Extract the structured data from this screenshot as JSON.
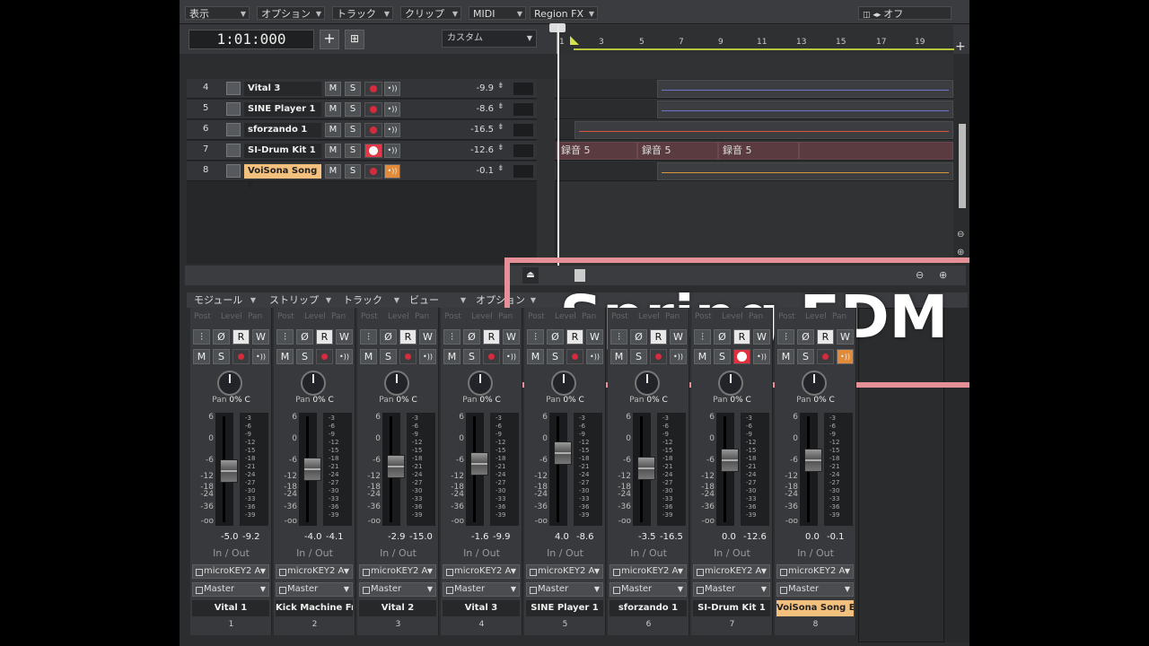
{
  "menu": [
    "表示",
    "オプション",
    "トラック",
    "クリップ",
    "MIDI",
    "Region FX"
  ],
  "menu_right": "オフ",
  "timecode": "1:01:000",
  "timebase": "カスタム",
  "ruler_ticks": [
    "1",
    "3",
    "5",
    "7",
    "9",
    "11",
    "13",
    "15",
    "17",
    "19"
  ],
  "tracks": [
    {
      "num": "4",
      "name": "Vital 3",
      "mute": "M",
      "solo": "S",
      "volume": "-9.9",
      "rec_active": false,
      "highlight": false
    },
    {
      "num": "5",
      "name": "SINE Player 1",
      "mute": "M",
      "solo": "S",
      "volume": "-8.6",
      "rec_active": false,
      "highlight": false
    },
    {
      "num": "6",
      "name": "sforzando 1",
      "mute": "M",
      "solo": "S",
      "volume": "-16.5",
      "rec_active": false,
      "highlight": false
    },
    {
      "num": "7",
      "name": "SI-Drum Kit 1",
      "mute": "M",
      "solo": "S",
      "volume": "-12.6",
      "rec_active": true,
      "highlight": false
    },
    {
      "num": "8",
      "name": "VoiSona Song E",
      "mute": "M",
      "solo": "S",
      "volume": "-0.1",
      "rec_active": false,
      "highlight": true
    }
  ],
  "clip_label": "録音 5",
  "mixer_menu": [
    "モジュール",
    "ストリップ",
    "トラック",
    "ビュー",
    "オプション"
  ],
  "strip_header": [
    "Post",
    "Level",
    "Pan"
  ],
  "strip_buttons": {
    "rw_read": "R",
    "rw_write": "W",
    "mute": "M",
    "solo": "S",
    "phase": "Ø"
  },
  "pan_label": "Pan",
  "pan_value": "0% C",
  "in_out_label": "In / Out",
  "input": "microKEY2 A",
  "output": "Master",
  "left_scale": [
    "6",
    "0",
    "-6",
    "-12",
    "-18",
    "-24",
    "-36",
    "-oo"
  ],
  "meter_scale": [
    "-3",
    "-6",
    "-9",
    "-12",
    "-15",
    "-18",
    "-21",
    "-24",
    "-27",
    "-30",
    "-33",
    "-36",
    "-39"
  ],
  "strips": [
    {
      "name": "Vital 1",
      "num": "1",
      "fader_db": "-5.0",
      "peak": "-9.2",
      "level": 0.4,
      "rec_active": false,
      "highlight": false
    },
    {
      "name": "Kick Machine Fr",
      "num": "2",
      "fader_db": "-4.0",
      "peak": "-4.1",
      "level": 0.42,
      "rec_active": false,
      "highlight": false
    },
    {
      "name": "Vital 2",
      "num": "3",
      "fader_db": "-2.9",
      "peak": "-15.0",
      "level": 0.45,
      "rec_active": false,
      "highlight": false
    },
    {
      "name": "Vital 3",
      "num": "4",
      "fader_db": "-1.6",
      "peak": "-9.9",
      "level": 0.48,
      "rec_active": false,
      "highlight": false
    },
    {
      "name": "SINE Player 1",
      "num": "5",
      "fader_db": "4.0",
      "peak": "-8.6",
      "level": 0.6,
      "rec_active": false,
      "highlight": false
    },
    {
      "name": "sforzando 1",
      "num": "6",
      "fader_db": "-3.5",
      "peak": "-16.5",
      "level": 0.43,
      "rec_active": false,
      "highlight": false
    },
    {
      "name": "SI-Drum Kit 1",
      "num": "7",
      "fader_db": "0.0",
      "peak": "-12.6",
      "level": 0.52,
      "rec_active": true,
      "highlight": false
    },
    {
      "name": "VoiSona Song E",
      "num": "8",
      "fader_db": "0.0",
      "peak": "-0.1",
      "level": 0.52,
      "rec_active": false,
      "highlight": true
    }
  ],
  "overlay_title": "Spring EDM",
  "colors": {
    "accent": "#f4c07e",
    "record": "#d42c3c",
    "overlay_border": "#e58f97",
    "loop": "#b7c53a"
  }
}
